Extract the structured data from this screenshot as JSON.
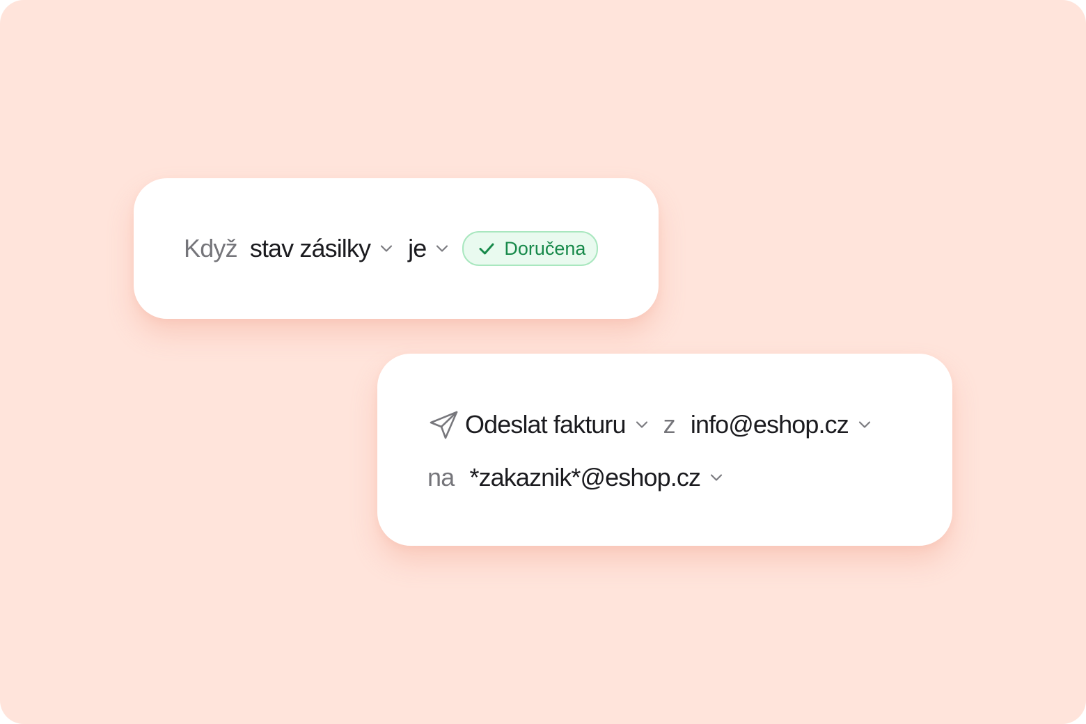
{
  "trigger": {
    "when_label": "Když",
    "field": "stav zásilky",
    "operator": "je",
    "value_badge": "Doručena"
  },
  "action": {
    "action_name": "Odeslat fakturu",
    "from_label": "z",
    "from_email": "info@eshop.cz",
    "to_label": "na",
    "to_email": "*zakaznik*@eshop.cz"
  },
  "icons": {
    "chevron": "chevron-down-icon",
    "check": "check-icon",
    "send": "send-icon"
  },
  "colors": {
    "background": "#ffe4db",
    "card": "#ffffff",
    "badge_bg": "#e9faef",
    "badge_border": "#a9e7bf",
    "badge_text": "#17894a",
    "text_primary": "#1b1b1f",
    "text_muted": "#75757a"
  }
}
